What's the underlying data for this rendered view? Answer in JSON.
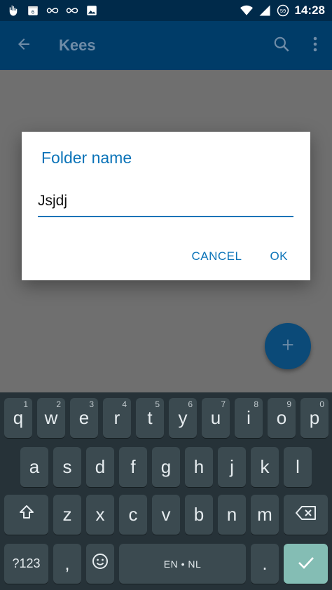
{
  "status_bar": {
    "time": "14:28",
    "icons": [
      "touch-hand-icon",
      "calendar-icon",
      "infinity-icon",
      "infinity-icon",
      "image-icon",
      "wifi-icon",
      "signal-icon",
      "battery-saver-icon"
    ],
    "battery_label": "59",
    "calendar_label": "6"
  },
  "app_bar": {
    "title": "Kees",
    "icons": [
      "back-arrow-icon",
      "search-icon",
      "more-vert-icon"
    ]
  },
  "dialog": {
    "title": "Folder name",
    "input_value": "Jsjdj",
    "cancel_label": "CANCEL",
    "ok_label": "OK"
  },
  "fab": {
    "icon": "plus-icon",
    "label": "+"
  },
  "keyboard": {
    "row1": [
      {
        "label": "q",
        "hint": "1"
      },
      {
        "label": "w",
        "hint": "2"
      },
      {
        "label": "e",
        "hint": "3"
      },
      {
        "label": "r",
        "hint": "4"
      },
      {
        "label": "t",
        "hint": "5"
      },
      {
        "label": "y",
        "hint": "6"
      },
      {
        "label": "u",
        "hint": "7"
      },
      {
        "label": "i",
        "hint": "8"
      },
      {
        "label": "o",
        "hint": "9"
      },
      {
        "label": "p",
        "hint": "0"
      }
    ],
    "row2": [
      "a",
      "s",
      "d",
      "f",
      "g",
      "h",
      "j",
      "k",
      "l"
    ],
    "row3": [
      "z",
      "x",
      "c",
      "v",
      "b",
      "n",
      "m"
    ],
    "symbols_label": "?123",
    "comma": ",",
    "space_label": "EN • NL",
    "period": ".",
    "shift_icon": "shift-icon",
    "backspace_icon": "backspace-icon",
    "emoji_icon": "emoji-icon",
    "enter_icon": "check-icon"
  },
  "colors": {
    "status_bar": "#002a4a",
    "app_bar": "#003c68",
    "accent": "#0a73b8",
    "keyboard_bg": "#263238",
    "key_bg": "#3b4a50",
    "enter_key": "#84bdb4"
  }
}
